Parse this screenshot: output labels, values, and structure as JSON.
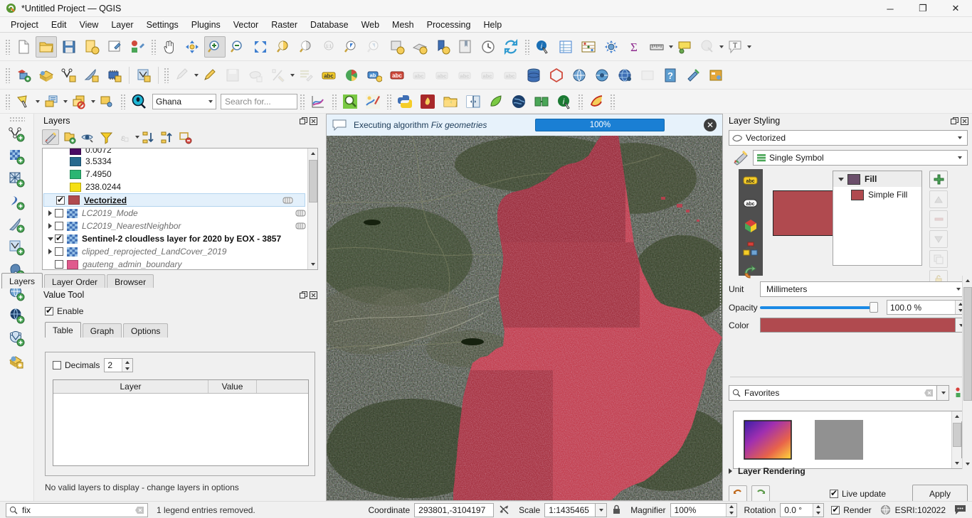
{
  "window": {
    "title": "*Untitled Project — QGIS",
    "minimize": "─",
    "maximize": "❐",
    "close": "✕"
  },
  "menu": [
    {
      "label": "Project"
    },
    {
      "label": "Edit"
    },
    {
      "label": "View"
    },
    {
      "label": "Layer"
    },
    {
      "label": "Settings"
    },
    {
      "label": "Plugins"
    },
    {
      "label": "Vector"
    },
    {
      "label": "Raster"
    },
    {
      "label": "Database"
    },
    {
      "label": "Web"
    },
    {
      "label": "Mesh"
    },
    {
      "label": "Processing"
    },
    {
      "label": "Help"
    }
  ],
  "toolbar_project": [
    {
      "name": "new-project-icon"
    },
    {
      "name": "open-project-icon"
    },
    {
      "name": "save-project-icon"
    },
    {
      "name": "save-project-as-icon"
    },
    {
      "name": "new-print-layout-icon"
    },
    {
      "name": "style-manager-icon"
    }
  ],
  "toolbar_nav": [
    {
      "name": "pan-map-icon"
    },
    {
      "name": "pan-to-selection-icon"
    },
    {
      "name": "zoom-in-icon"
    },
    {
      "name": "zoom-out-icon"
    },
    {
      "name": "zoom-full-icon"
    },
    {
      "name": "zoom-to-selection-icon"
    },
    {
      "name": "zoom-to-layer-icon"
    },
    {
      "name": "zoom-native-icon"
    },
    {
      "name": "zoom-last-icon"
    },
    {
      "name": "zoom-next-icon"
    },
    {
      "name": "refresh-icon"
    }
  ],
  "map_search": {
    "locator_scope": "Ghana",
    "search_placeholder": "Search for..."
  },
  "msgbar": {
    "text_prefix": "Executing algorithm ",
    "algorithm": "Fix geometries",
    "progress_label": "100%",
    "progress_value": 100,
    "close": "✕"
  },
  "layers_dock": {
    "title": "Layers",
    "toolbar": [
      {
        "name": "open-layer-styling-panel-icon",
        "active": true
      },
      {
        "name": "add-group-icon"
      },
      {
        "name": "manage-map-themes-icon"
      },
      {
        "name": "filter-legend-icon"
      },
      {
        "name": "filter-legend-by-expression-icon"
      },
      {
        "name": "expand-all-icon"
      },
      {
        "name": "collapse-all-icon"
      },
      {
        "name": "remove-layer-icon"
      }
    ],
    "legend_classes": [
      {
        "label": "0.0072",
        "color": "#4b0a63"
      },
      {
        "label": "3.5334",
        "color": "#26698e"
      },
      {
        "label": "7.4950",
        "color": "#2bb673"
      },
      {
        "label": "238.0244",
        "color": "#f5e014"
      }
    ],
    "items": [
      {
        "label": "Vectorized",
        "checked": true,
        "style": "selected",
        "type": "vector",
        "color": "#b04a4f",
        "expandable": false,
        "editable": true
      },
      {
        "label": "LC2019_Mode",
        "checked": false,
        "style": "italic",
        "type": "raster",
        "expandable": true,
        "editable": true
      },
      {
        "label": "LC2019_NearestNeighbor",
        "checked": false,
        "style": "italic",
        "type": "raster",
        "expandable": true,
        "editable": true
      },
      {
        "label": "Sentinel-2 cloudless layer for 2020 by EOX - 3857",
        "checked": true,
        "style": "bold",
        "type": "raster",
        "expandable": true,
        "expanded": true,
        "editable": false
      },
      {
        "label": "clipped_reprojected_LandCover_2019",
        "checked": false,
        "style": "italic",
        "type": "raster",
        "expandable": true,
        "editable": false
      },
      {
        "label": "gauteng_admin_boundary",
        "checked": false,
        "style": "italic",
        "type": "vector",
        "color": "#e05a8d",
        "expandable": false,
        "editable": false
      }
    ]
  },
  "dock_tabs": [
    {
      "label": "Layers",
      "selected": true
    },
    {
      "label": "Layer Order",
      "selected": false
    },
    {
      "label": "Browser",
      "selected": false
    }
  ],
  "value_tool": {
    "title": "Value Tool",
    "enable_label": "Enable",
    "enable_checked": true,
    "tabs": [
      {
        "label": "Table",
        "selected": true
      },
      {
        "label": "Graph",
        "selected": false
      },
      {
        "label": "Options",
        "selected": false
      }
    ],
    "decimals_label": "Decimals",
    "decimals_checked": false,
    "decimals_value": "2",
    "table_headers": [
      "Layer",
      "Value"
    ],
    "table_rows": [],
    "status": "No valid layers to display - change layers in options"
  },
  "layer_styling": {
    "title": "Layer Styling",
    "layer_name": "Vectorized",
    "renderer": "Single Symbol",
    "side_tabs": [
      {
        "name": "labels-icon"
      },
      {
        "name": "masks-icon"
      },
      {
        "name": "3d-view-icon"
      },
      {
        "name": "diagrams-icon"
      },
      {
        "name": "actions-icon"
      }
    ],
    "symbol_tree": [
      {
        "label": "Fill",
        "color": "#6b4f6b",
        "level": 0,
        "expanded": true
      },
      {
        "label": "Simple Fill",
        "color": "#b04a4f",
        "level": 1
      }
    ],
    "symbol_preview_color": "#b04a4f",
    "buttons": [
      {
        "name": "add-symbol-layer-button",
        "glyph": "+",
        "enabled": true
      },
      {
        "name": "move-symbol-up-button",
        "glyph": "▲",
        "enabled": false
      },
      {
        "name": "remove-symbol-layer-button",
        "glyph": "−",
        "enabled": false
      },
      {
        "name": "move-symbol-down-button",
        "glyph": "▼",
        "enabled": false
      },
      {
        "name": "duplicate-symbol-layer-button",
        "glyph": "⧉",
        "enabled": false
      },
      {
        "name": "lock-symbol-color-button",
        "glyph": "⚿",
        "enabled": false
      }
    ],
    "unit_label": "Unit",
    "unit_value": "Millimeters",
    "opacity_label": "Opacity",
    "opacity_value": "100.0 %",
    "opacity_percent": 100,
    "color_label": "Color",
    "color_value": "#b04a4f",
    "favorites_value": "Favorites",
    "gallery": [
      {
        "name": "gradient-symbol",
        "kind": "gradient"
      },
      {
        "name": "gray-symbol",
        "kind": "solid",
        "color": "#919191"
      }
    ],
    "layer_rendering_label": "Layer Rendering",
    "live_update_label": "Live update",
    "live_update_checked": true,
    "apply_label": "Apply",
    "undo_name": "undo-button",
    "redo_name": "redo-button"
  },
  "statusbar": {
    "search_value": "fix",
    "message": "1 legend entries removed.",
    "coordinate_label": "Coordinate",
    "coordinate_value": "293801,-3104197",
    "scale_label": "Scale",
    "scale_value": "1:1435465",
    "magnifier_label": "Magnifier",
    "magnifier_value": "100%",
    "rotation_label": "Rotation",
    "rotation_value": "0.0 °",
    "render_label": "Render",
    "render_checked": true,
    "crs_label": "ESRI:102022"
  }
}
